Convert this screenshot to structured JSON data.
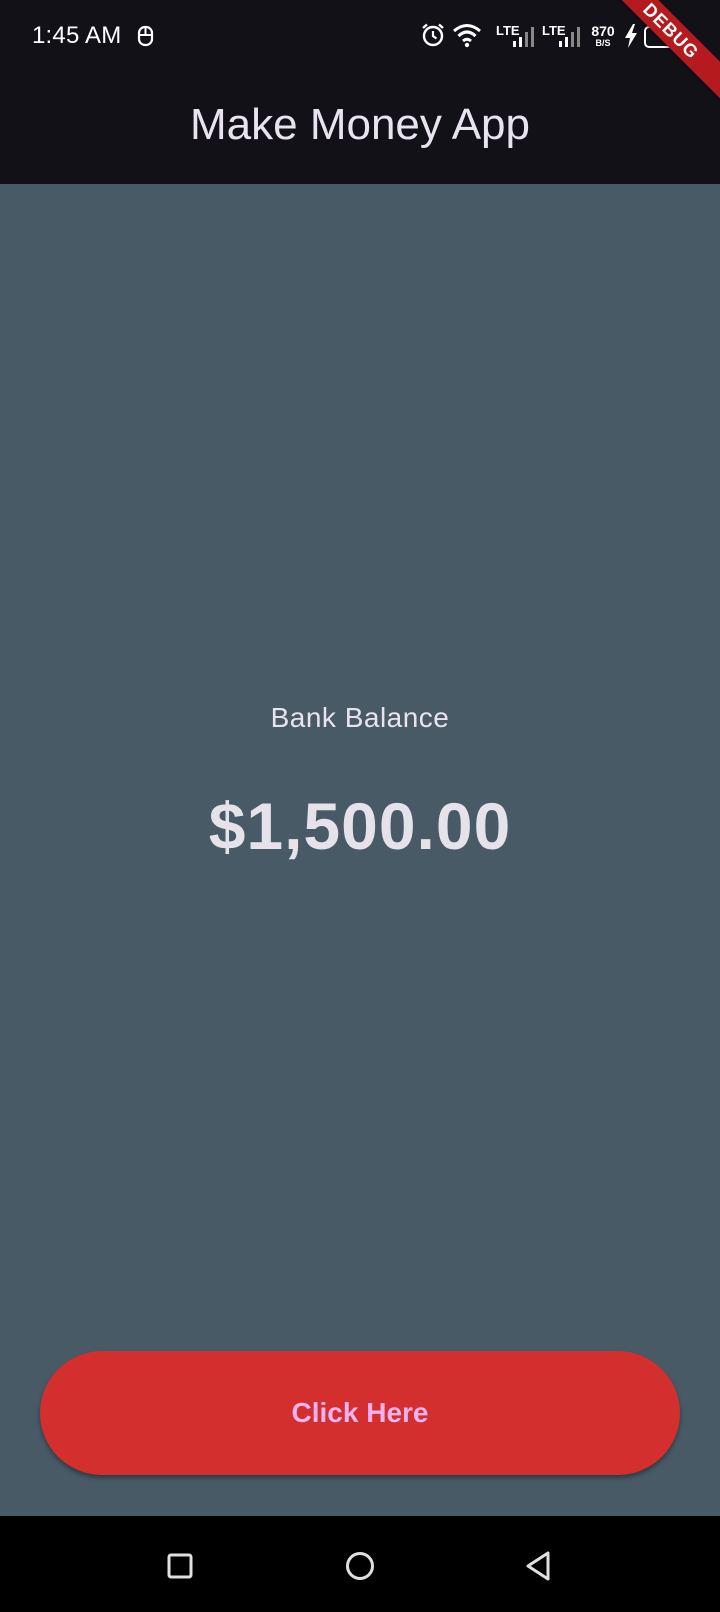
{
  "status_bar": {
    "time": "1:45 AM",
    "network_1": "LTE",
    "network_2": "LTE",
    "speed_value": "870",
    "speed_unit": "B/S",
    "icons": [
      "mouse-icon",
      "alarm-icon",
      "wifi-icon",
      "signal-icon",
      "signal-icon",
      "charging-icon",
      "battery-icon"
    ]
  },
  "debug_banner": "DEBUG",
  "app_bar": {
    "title": "Make Money App"
  },
  "balance": {
    "label": "Bank Balance",
    "amount": "$1,500.00"
  },
  "action_button": {
    "label": "Click Here"
  },
  "nav_bar": {
    "buttons": [
      "recents",
      "home",
      "back"
    ]
  },
  "colors": {
    "background": "#475a66",
    "bar": "#131118",
    "button": "#d32f2f",
    "button_text": "#f0b3ee",
    "debug": "#b51a1e"
  }
}
